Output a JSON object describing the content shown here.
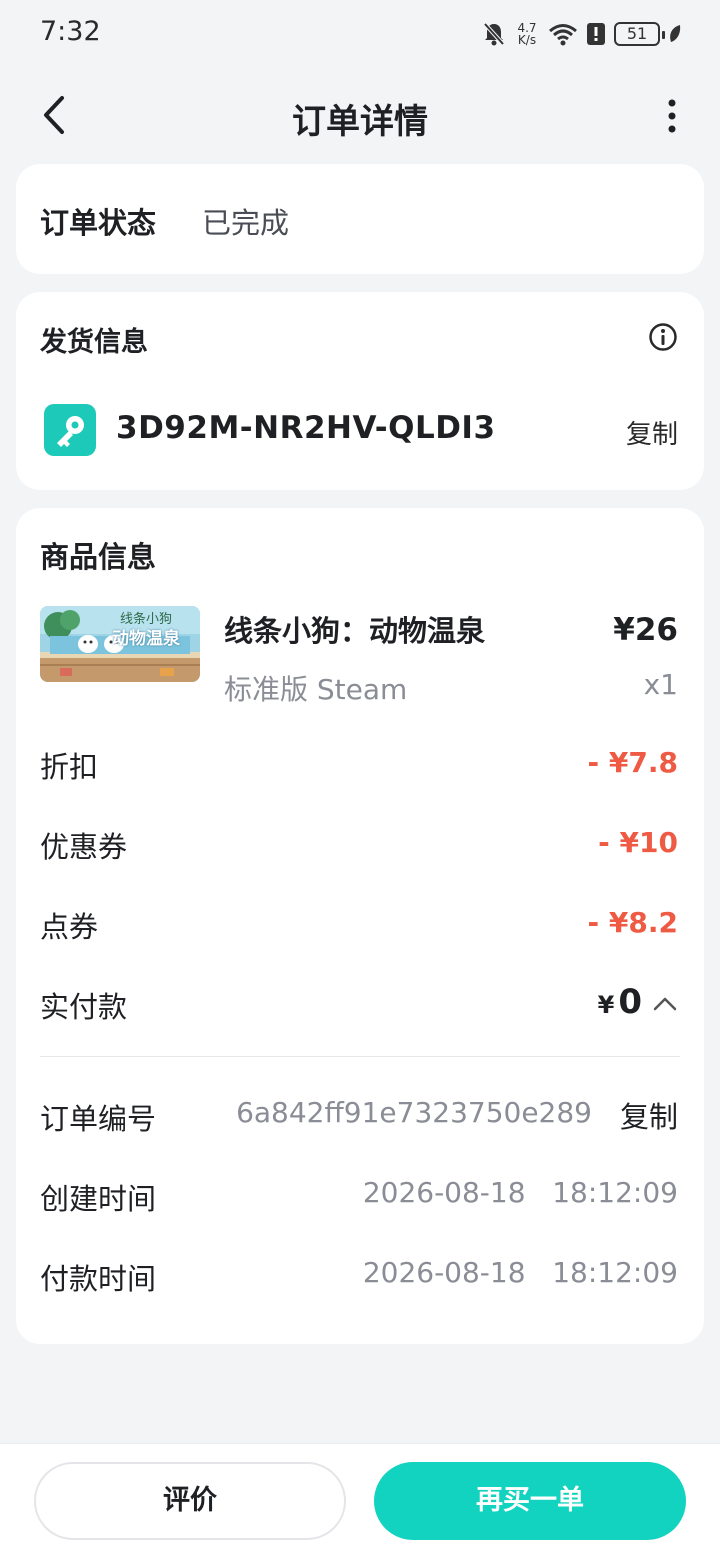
{
  "status_bar": {
    "time": "7:32",
    "net_speed_top": "4.7",
    "net_speed_bottom": "K/s",
    "battery": "51"
  },
  "header": {
    "title": "订单详情"
  },
  "order_status": {
    "label": "订单状态",
    "value": "已完成"
  },
  "delivery": {
    "title": "发货信息",
    "key_code": "3D92M-NR2HV-QLDI3",
    "copy_label": "复制"
  },
  "product": {
    "section_title": "商品信息",
    "name": "线条小狗：动物温泉",
    "price": "¥26",
    "edition": "标准版 Steam",
    "quantity": "x1",
    "thumb_text_top": "线条小狗",
    "thumb_text_bottom": "动物温泉"
  },
  "pricing": {
    "discount_label": "折扣",
    "discount_value": "- ¥7.8",
    "coupon_label": "优惠券",
    "coupon_value": "- ¥10",
    "points_label": "点券",
    "points_value": "- ¥8.2",
    "paid_label": "实付款",
    "paid_currency": "¥",
    "paid_amount": "0"
  },
  "order_meta": {
    "order_no_label": "订单编号",
    "order_no": "6a842ff91e7323750e289",
    "order_no_copy": "复制",
    "created_label": "创建时间",
    "created_value": "2026-08-18   18:12:09",
    "paid_time_label": "付款时间",
    "paid_time_value": "2026-08-18   18:12:09"
  },
  "actions": {
    "review": "评价",
    "rebuy": "再买一单"
  },
  "colors": {
    "accent": "#12d3bf",
    "discount_red": "#ef5a44",
    "background": "#f3f4f6"
  }
}
